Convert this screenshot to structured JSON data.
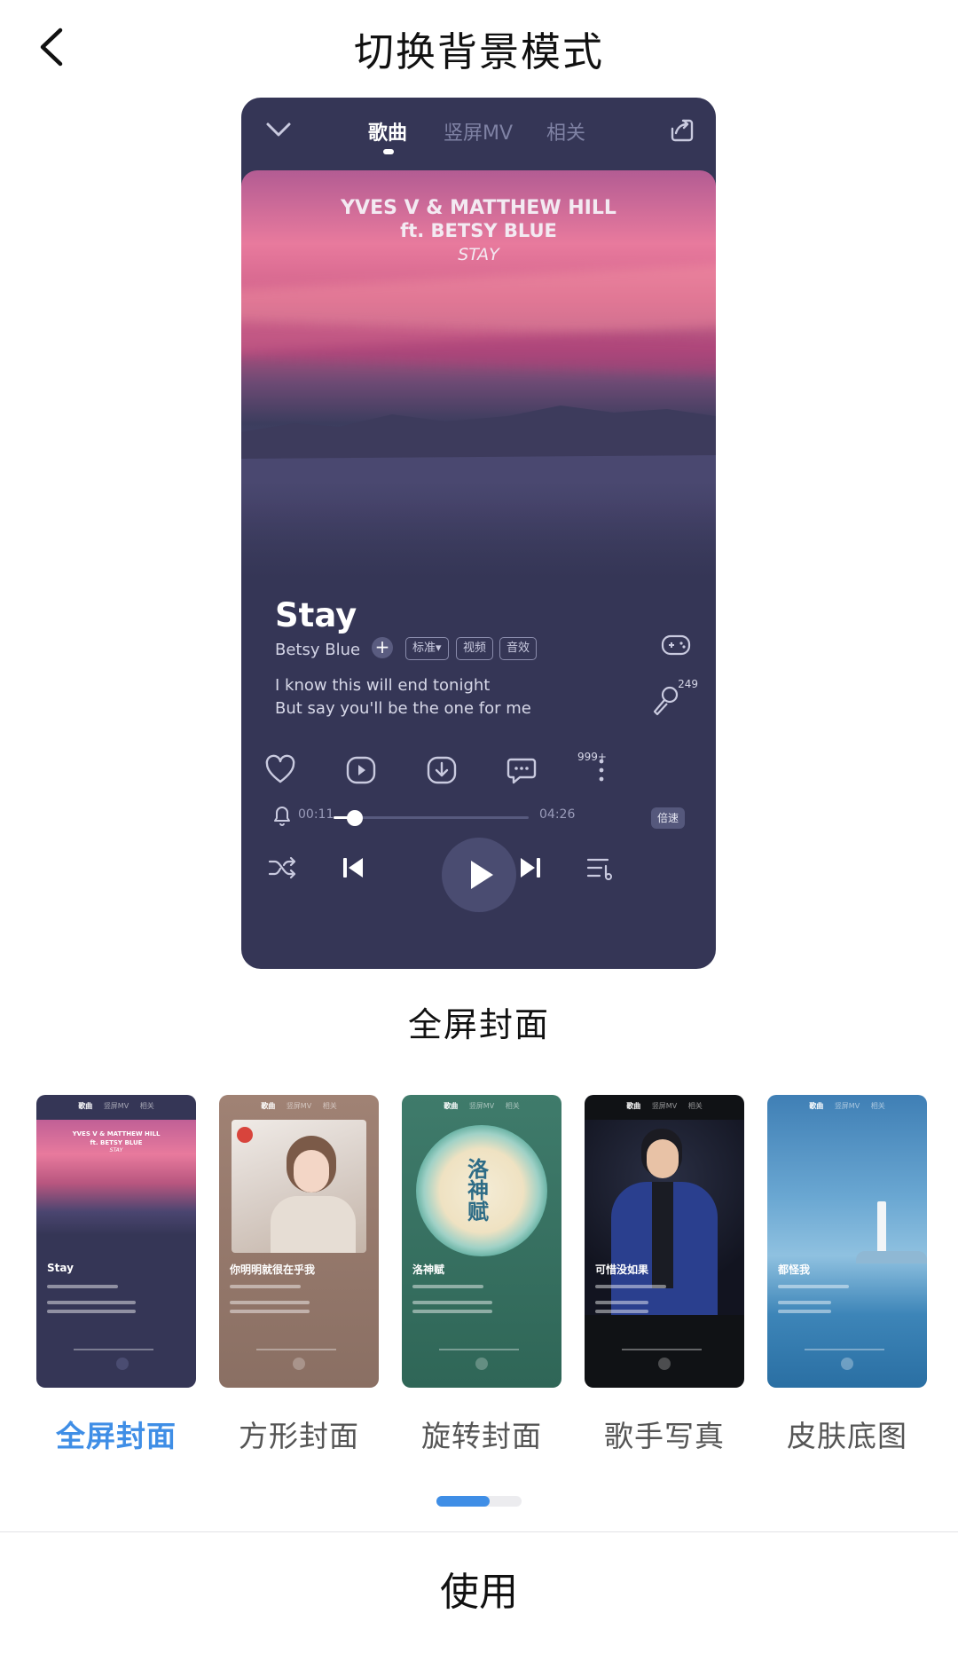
{
  "header": {
    "title": "切换背景模式"
  },
  "preview": {
    "tabs": [
      "歌曲",
      "竖屏MV",
      "相关"
    ],
    "cover_text": [
      "YVES V & MATTHEW HILL",
      "ft. BETSY BLUE",
      "STAY"
    ],
    "song_title": "Stay",
    "artist": "Betsy Blue",
    "tags": [
      "标准▾",
      "视频",
      "音效"
    ],
    "lyrics": [
      "I know this will end tonight",
      "But say you'll be the one for me"
    ],
    "mic_count": "249",
    "comment_count": "999+",
    "time_current": "00:11",
    "time_total": "04:26",
    "progress": 0.11,
    "speed_label": "倍速",
    "accent": "#353656"
  },
  "caption": "全屏封面",
  "modes": [
    {
      "label": "全屏封面",
      "title": "Stay",
      "selected": true
    },
    {
      "label": "方形封面",
      "title": "你明明就很在乎我",
      "selected": false
    },
    {
      "label": "旋转封面",
      "title": "洛神赋",
      "selected": false
    },
    {
      "label": "歌手写真",
      "title": "可惜没如果",
      "selected": false
    },
    {
      "label": "皮肤底图",
      "title": "都怪我",
      "selected": false
    }
  ],
  "mini_cover_text": [
    "YVES V & MATTHEW HILL",
    "ft. BETSY BLUE",
    "STAY"
  ],
  "mini_tabs": [
    "歌曲",
    "竖屏MV",
    "相关"
  ],
  "disc_text": "洛神赋",
  "use_button": "使用",
  "colors": {
    "selected": "#3f8ee6"
  }
}
